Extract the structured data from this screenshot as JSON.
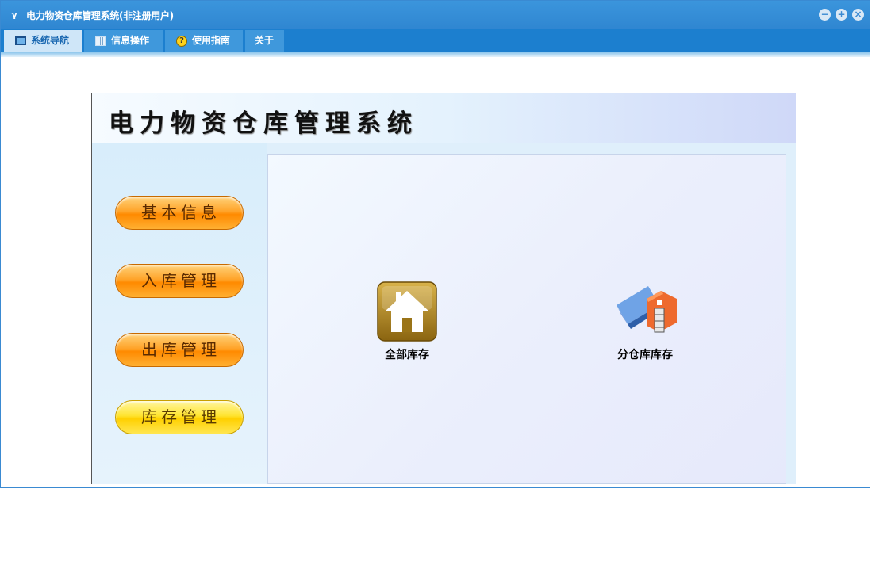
{
  "window": {
    "title": "电力物资仓库管理系统(非注册用户)",
    "controls": {
      "minimize": "−",
      "maximize": "+",
      "close": "×"
    }
  },
  "menu": {
    "tabs": [
      {
        "label": "系统导航",
        "icon": "monitor-icon",
        "active": true
      },
      {
        "label": "信息操作",
        "icon": "grid-icon",
        "active": false
      },
      {
        "label": "使用指南",
        "icon": "help-icon",
        "active": false
      },
      {
        "label": "关于",
        "icon": "",
        "active": false
      }
    ]
  },
  "header": {
    "title": "电力物资仓库管理系统"
  },
  "nav": {
    "buttons": [
      {
        "label": "基本信息"
      },
      {
        "label": "入库管理"
      },
      {
        "label": "出库管理"
      },
      {
        "label": "库存管理"
      }
    ]
  },
  "shortcuts": [
    {
      "label": "全部库存",
      "icon": "home-icon"
    },
    {
      "label": "分仓库库存",
      "icon": "warehouse-icon"
    }
  ],
  "colors": {
    "titlebar": "#3b95dc",
    "menubar": "#1c7fcf",
    "accent_orange": "#ff8a00",
    "accent_yellow": "#ffd000"
  }
}
